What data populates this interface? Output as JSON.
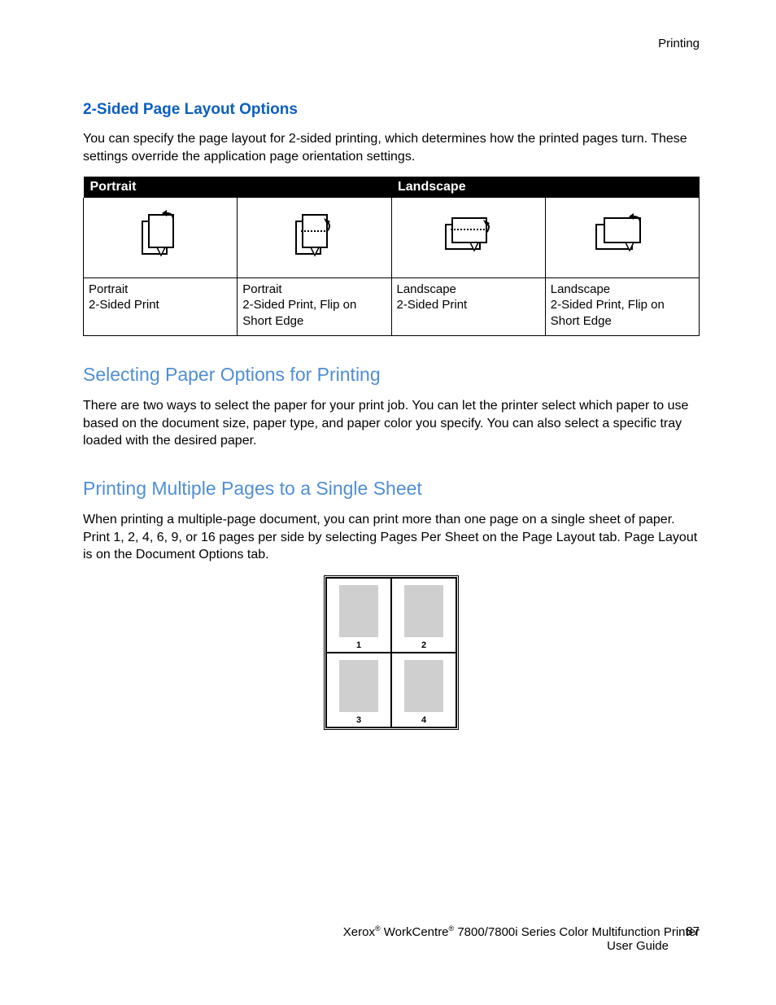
{
  "header": {
    "section": "Printing"
  },
  "h1": "2-Sided Page Layout Options",
  "p1": "You can specify the page layout for 2-sided printing, which determines how the printed pages turn. These settings override the application page orientation settings.",
  "table": {
    "col_portrait": "Portrait",
    "col_landscape": "Landscape",
    "cells": [
      {
        "line1": "Portrait",
        "line2": "2-Sided Print"
      },
      {
        "line1": "Portrait",
        "line2": "2-Sided Print, Flip on Short Edge"
      },
      {
        "line1": "Landscape",
        "line2": "2-Sided Print"
      },
      {
        "line1": "Landscape",
        "line2": "2-Sided Print, Flip on Short Edge"
      }
    ]
  },
  "h2": "Selecting Paper Options for Printing",
  "p2": "There are two ways to select the paper for your print job. You can let the printer select which paper to use based on the document size, paper type, and paper color you specify. You can also select a specific tray loaded with the desired paper.",
  "h3": "Printing Multiple Pages to a Single Sheet",
  "p3": "When printing a multiple-page document, you can print more than one page on a single sheet of paper. Print 1, 2, 4, 6, 9, or 16 pages per side by selecting Pages Per Sheet on the Page Layout tab. Page Layout is on the Document Options tab.",
  "nup": {
    "1": "1",
    "2": "2",
    "3": "3",
    "4": "4"
  },
  "footer": {
    "brand1": "Xerox",
    "brand2": "WorkCentre",
    "rest": " 7800/7800i Series Color Multifunction Printer",
    "sub": "User Guide",
    "page": "87"
  }
}
